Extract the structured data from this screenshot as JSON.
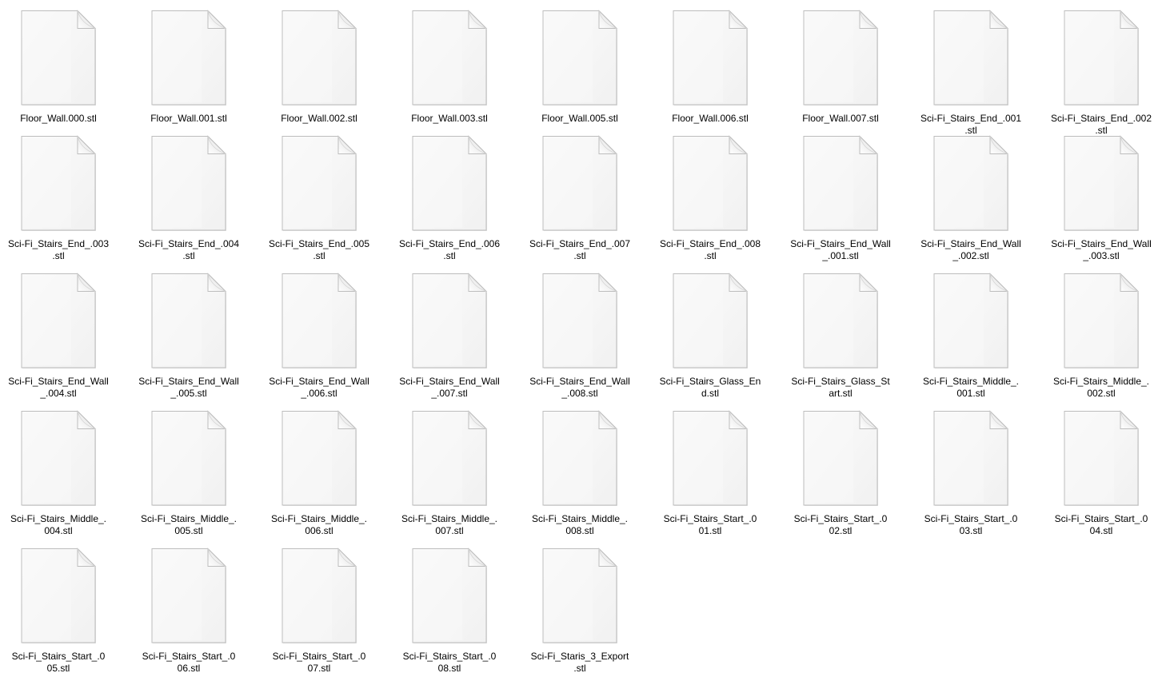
{
  "view": "large-icons",
  "colors": {
    "background": "#ffffff",
    "page_fill": "#f8f8f8",
    "page_border": "#bdbdbd",
    "label_text": "#000000"
  },
  "files": [
    {
      "name": "Floor_Wall.000.stl",
      "icon": "document-icon"
    },
    {
      "name": "Floor_Wall.001.stl",
      "icon": "document-icon"
    },
    {
      "name": "Floor_Wall.002.stl",
      "icon": "document-icon"
    },
    {
      "name": "Floor_Wall.003.stl",
      "icon": "document-icon"
    },
    {
      "name": "Floor_Wall.005.stl",
      "icon": "document-icon"
    },
    {
      "name": "Floor_Wall.006.stl",
      "icon": "document-icon"
    },
    {
      "name": "Floor_Wall.007.stl",
      "icon": "document-icon"
    },
    {
      "name": "Sci-Fi_Stairs_End_.001.stl",
      "icon": "document-icon"
    },
    {
      "name": "Sci-Fi_Stairs_End_.002.stl",
      "icon": "document-icon"
    },
    {
      "name": "Sci-Fi_Stairs_End_.003.stl",
      "icon": "document-icon"
    },
    {
      "name": "Sci-Fi_Stairs_End_.004.stl",
      "icon": "document-icon"
    },
    {
      "name": "Sci-Fi_Stairs_End_.005.stl",
      "icon": "document-icon"
    },
    {
      "name": "Sci-Fi_Stairs_End_.006.stl",
      "icon": "document-icon"
    },
    {
      "name": "Sci-Fi_Stairs_End_.007.stl",
      "icon": "document-icon"
    },
    {
      "name": "Sci-Fi_Stairs_End_.008.stl",
      "icon": "document-icon"
    },
    {
      "name": "Sci-Fi_Stairs_End_Wall_.001.stl",
      "icon": "document-icon"
    },
    {
      "name": "Sci-Fi_Stairs_End_Wall_.002.stl",
      "icon": "document-icon"
    },
    {
      "name": "Sci-Fi_Stairs_End_Wall_.003.stl",
      "icon": "document-icon"
    },
    {
      "name": "Sci-Fi_Stairs_End_Wall_.004.stl",
      "icon": "document-icon"
    },
    {
      "name": "Sci-Fi_Stairs_End_Wall_.005.stl",
      "icon": "document-icon"
    },
    {
      "name": "Sci-Fi_Stairs_End_Wall_.006.stl",
      "icon": "document-icon"
    },
    {
      "name": "Sci-Fi_Stairs_End_Wall_.007.stl",
      "icon": "document-icon"
    },
    {
      "name": "Sci-Fi_Stairs_End_Wall_.008.stl",
      "icon": "document-icon"
    },
    {
      "name": "Sci-Fi_Stairs_Glass_End.stl",
      "icon": "document-icon"
    },
    {
      "name": "Sci-Fi_Stairs_Glass_Start.stl",
      "icon": "document-icon"
    },
    {
      "name": "Sci-Fi_Stairs_Middle_.001.stl",
      "icon": "document-icon"
    },
    {
      "name": "Sci-Fi_Stairs_Middle_.002.stl",
      "icon": "document-icon"
    },
    {
      "name": "Sci-Fi_Stairs_Middle_.004.stl",
      "icon": "document-icon"
    },
    {
      "name": "Sci-Fi_Stairs_Middle_.005.stl",
      "icon": "document-icon"
    },
    {
      "name": "Sci-Fi_Stairs_Middle_.006.stl",
      "icon": "document-icon"
    },
    {
      "name": "Sci-Fi_Stairs_Middle_.007.stl",
      "icon": "document-icon"
    },
    {
      "name": "Sci-Fi_Stairs_Middle_.008.stl",
      "icon": "document-icon"
    },
    {
      "name": "Sci-Fi_Stairs_Start_.001.stl",
      "icon": "document-icon"
    },
    {
      "name": "Sci-Fi_Stairs_Start_.002.stl",
      "icon": "document-icon"
    },
    {
      "name": "Sci-Fi_Stairs_Start_.003.stl",
      "icon": "document-icon"
    },
    {
      "name": "Sci-Fi_Stairs_Start_.004.stl",
      "icon": "document-icon"
    },
    {
      "name": "Sci-Fi_Stairs_Start_.005.stl",
      "icon": "document-icon"
    },
    {
      "name": "Sci-Fi_Stairs_Start_.006.stl",
      "icon": "document-icon"
    },
    {
      "name": "Sci-Fi_Stairs_Start_.007.stl",
      "icon": "document-icon"
    },
    {
      "name": "Sci-Fi_Stairs_Start_.008.stl",
      "icon": "document-icon"
    },
    {
      "name": "Sci-Fi_Staris_3_Export.stl",
      "icon": "document-icon"
    }
  ]
}
